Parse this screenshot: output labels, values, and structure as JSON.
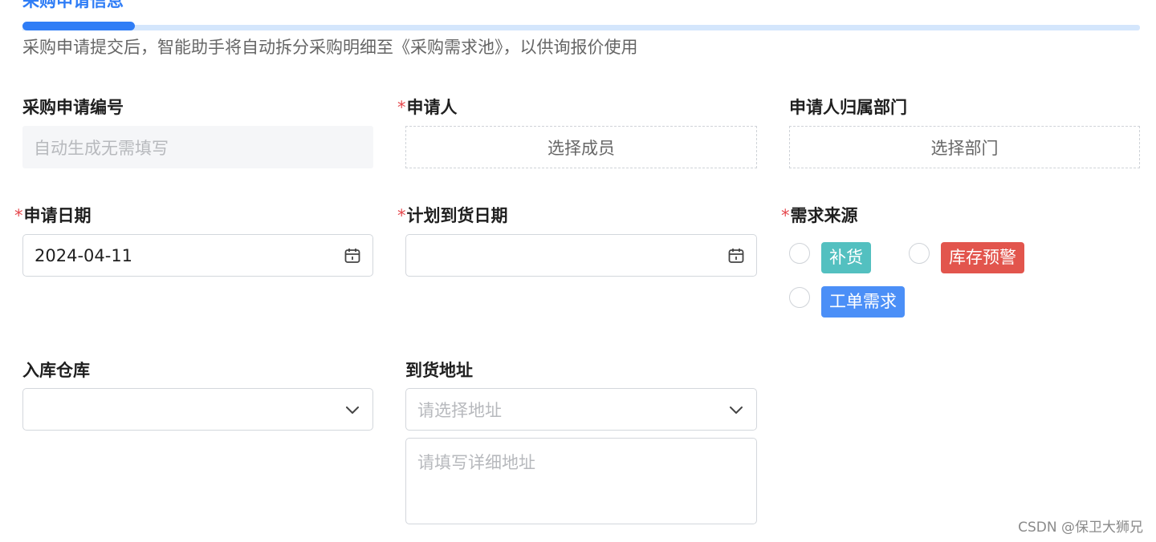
{
  "section": {
    "title": "采购申请信息",
    "description": "采购申请提交后，智能助手将自动拆分采购明细至《采购需求池》，以供询报价使用"
  },
  "fields": {
    "request_no": {
      "label": "采购申请编号",
      "placeholder": "自动生成无需填写"
    },
    "applicant": {
      "required_mark": "*",
      "label": "申请人",
      "placeholder": "选择成员"
    },
    "department": {
      "label": "申请人归属部门",
      "placeholder": "选择部门"
    },
    "apply_date": {
      "required_mark": "*",
      "label": "申请日期",
      "value": "2024-04-11",
      "icon": "calendar-icon"
    },
    "arrival_date": {
      "required_mark": "*",
      "label": "计划到货日期",
      "value": "",
      "icon": "calendar-icon"
    },
    "source": {
      "required_mark": "*",
      "label": "需求来源",
      "options": [
        {
          "label": "补货",
          "color": "#53c0c0"
        },
        {
          "label": "库存预警",
          "color": "#e2554d"
        },
        {
          "label": "工单需求",
          "color": "#4b8ff7"
        }
      ]
    },
    "warehouse": {
      "label": "入库仓库",
      "value": "",
      "icon": "chevron-down-icon"
    },
    "address": {
      "label": "到货地址",
      "placeholder": "请选择地址",
      "detail_placeholder": "请填写详细地址",
      "icon": "chevron-down-icon"
    }
  },
  "watermark": "CSDN @保卫大狮兄"
}
